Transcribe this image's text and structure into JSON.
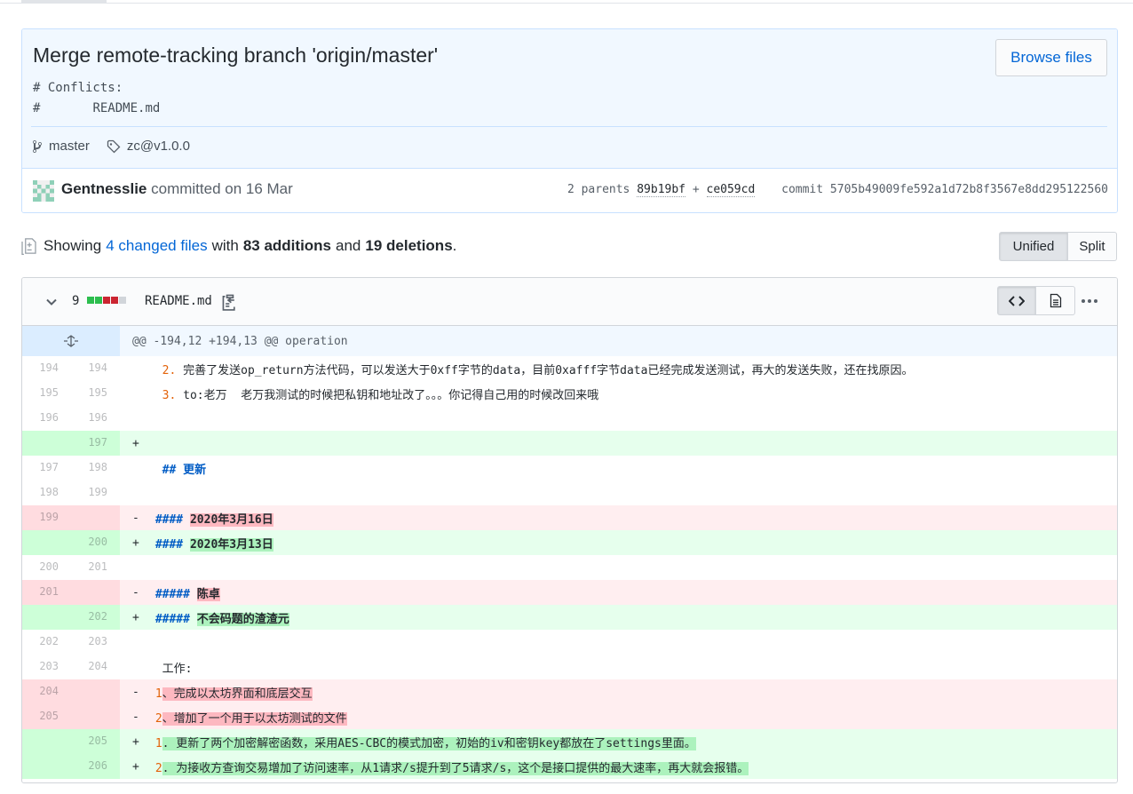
{
  "commit": {
    "title": "Merge remote-tracking branch 'origin/master'",
    "description": "# Conflicts:\n#\tREADME.md",
    "browse_label": "Browse files",
    "branch": "master",
    "tag": "zc@v1.0.0",
    "author": "Gentnesslie",
    "committed_text": "committed on 16 Mar",
    "parents_label": "2 parents",
    "parent_1": "89b19bf",
    "parent_sep": "+",
    "parent_2": "ce059cd",
    "commit_label": "commit",
    "commit_sha": "5705b49009fe592a1d72b8f3567e8dd295122560"
  },
  "summary": {
    "showing": "Showing",
    "changed_files": "4 changed files",
    "with": "with",
    "additions": "83 additions",
    "and": "and",
    "deletions": "19 deletions",
    "end": ".",
    "unified_label": "Unified",
    "split_label": "Split"
  },
  "file": {
    "change_count": "9",
    "name": "README.md",
    "stat_colors": [
      "#2cbe4e",
      "#2cbe4e",
      "#cb2431",
      "#cb2431",
      "#d1d5da"
    ]
  },
  "diff": {
    "hunk_header": "@@ -194,12 +194,13 @@ operation",
    "lines": [
      {
        "old": "194",
        "new": "194",
        "sign": " ",
        "num": "2.",
        "text": " 完善了发送op_return方法代码，可以发送大于0xff字节的data，目前0xafff字节data已经完成发送测试，再大的发送失败，还在找原因。"
      },
      {
        "old": "195",
        "new": "195",
        "sign": " ",
        "num": "3.",
        "text": " to:老万  老万我测试的时候把私钥和地址改了。。。你记得自己用的时候改回来哦"
      },
      {
        "old": "196",
        "new": "196",
        "sign": " ",
        "text": ""
      },
      {
        "old": "",
        "new": "197",
        "sign": "+",
        "text": ""
      },
      {
        "old": "197",
        "new": "198",
        "sign": " ",
        "head": "## 更新",
        "text": ""
      },
      {
        "old": "198",
        "new": "199",
        "sign": " ",
        "text": ""
      },
      {
        "old": "199",
        "new": "",
        "sign": "-",
        "head": "####",
        "hl": "2020年3月16日"
      },
      {
        "old": "",
        "new": "200",
        "sign": "+",
        "head": "####",
        "hl": "2020年3月13日"
      },
      {
        "old": "200",
        "new": "201",
        "sign": " ",
        "text": ""
      },
      {
        "old": "201",
        "new": "",
        "sign": "-",
        "head": "#####",
        "hl": "陈卓"
      },
      {
        "old": "",
        "new": "202",
        "sign": "+",
        "head": "#####",
        "hl": "不会码题的渣渣元"
      },
      {
        "old": "202",
        "new": "203",
        "sign": " ",
        "text": ""
      },
      {
        "old": "203",
        "new": "204",
        "sign": " ",
        "text": "工作:"
      },
      {
        "old": "204",
        "new": "",
        "sign": "-",
        "pre": "1",
        "hl": "、完成以太坊界面和底层交互"
      },
      {
        "old": "205",
        "new": "",
        "sign": "-",
        "pre": "2",
        "hl": "、增加了一个用于以太坊测试的文件"
      },
      {
        "old": "",
        "new": "205",
        "sign": "+",
        "pre": "1",
        "hl": ". 更新了两个加密解密函数，采用AES-CBC的模式加密，初始的iv和密钥key都放在了settings里面。"
      },
      {
        "old": "",
        "new": "206",
        "sign": "+",
        "pre": "2",
        "hl": ". 为接收方查询交易增加了访问速率，从1请求/s提升到了5请求/s，这个是接口提供的最大速率，再大就会报错。"
      }
    ]
  }
}
